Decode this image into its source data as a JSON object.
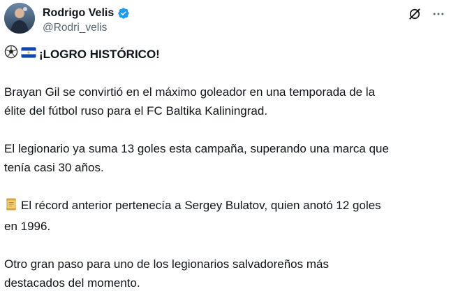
{
  "author": {
    "display_name": "Rodrigo Velis",
    "handle": "@Rodri_velis",
    "verified_icon": "verified-badge-icon"
  },
  "actions": {
    "grok_icon": "grok-icon",
    "more_icon": "more-options-icon"
  },
  "post": {
    "headline_emojis": [
      "soccer-ball-icon",
      "el-salvador-flag-icon"
    ],
    "headline": "¡LOGRO HISTÓRICO!",
    "para1_line1": "Brayan Gil se convirtió en el máximo goleador en una temporada de la",
    "para1_line2": "élite del fútbol ruso para el FC Baltika Kaliningrad.",
    "para2_line1": "El legionario ya suma 13 goles esta campaña, superando una marca que",
    "para2_line2": "tenía casi 30 años.",
    "para3_emoji": "scroll-icon",
    "para3_line1": "El récord anterior pertenecía a Sergey Bulatov, quien anotó 12 goles",
    "para3_line2": "en 1996.",
    "para4_line1": "Otro gran paso para uno de los legionarios salvadoreños más",
    "para4_line2": "destacados del momento."
  },
  "colors": {
    "text": "#0f1419",
    "secondary": "#536471",
    "verified": "#1d9bf0",
    "flag_blue": "#0f47af"
  }
}
